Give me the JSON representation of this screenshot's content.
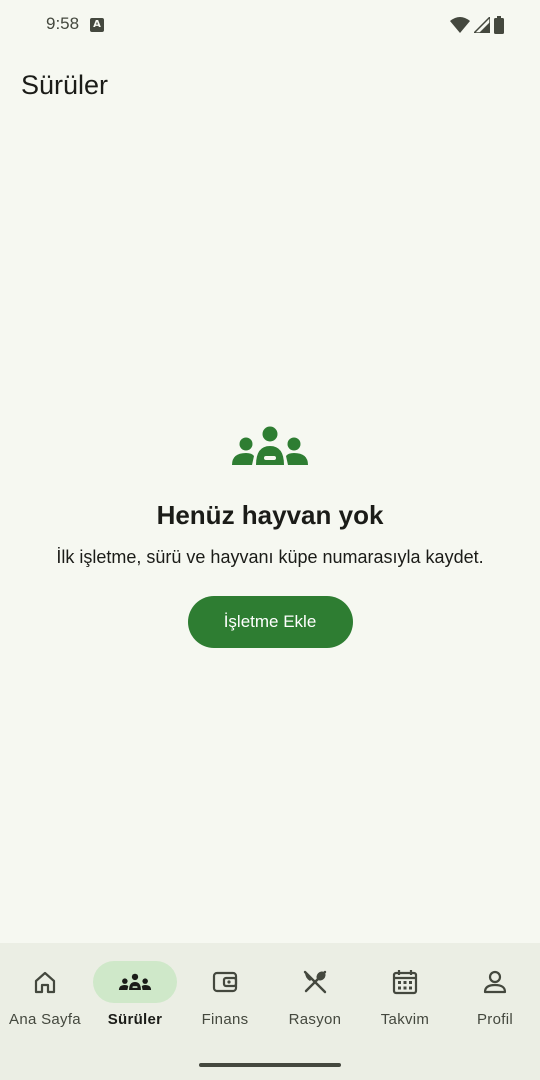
{
  "status_bar": {
    "time": "9:58",
    "notification_icon": "a-notification-icon",
    "wifi_icon": "wifi-icon",
    "signal_icon": "signal-icon",
    "battery_icon": "battery-icon"
  },
  "page": {
    "title": "Sürüler"
  },
  "empty_state": {
    "icon": "groups-icon",
    "title": "Henüz hayvan yok",
    "description": "İlk işletme, sürü ve hayvanı küpe numarasıyla kaydet.",
    "button_label": "İşletme Ekle"
  },
  "bottom_nav": {
    "items": [
      {
        "label": "Ana Sayfa",
        "icon": "home-icon",
        "active": false
      },
      {
        "label": "Sürüler",
        "icon": "groups-icon",
        "active": true
      },
      {
        "label": "Finans",
        "icon": "wallet-icon",
        "active": false
      },
      {
        "label": "Rasyon",
        "icon": "utensils-icon",
        "active": false
      },
      {
        "label": "Takvim",
        "icon": "calendar-icon",
        "active": false
      },
      {
        "label": "Profil",
        "icon": "person-icon",
        "active": false
      }
    ]
  },
  "colors": {
    "background": "#f6f8f1",
    "primary": "#2e7d32",
    "active_indicator": "#cfe8c9",
    "nav_background": "#ebeee4"
  }
}
